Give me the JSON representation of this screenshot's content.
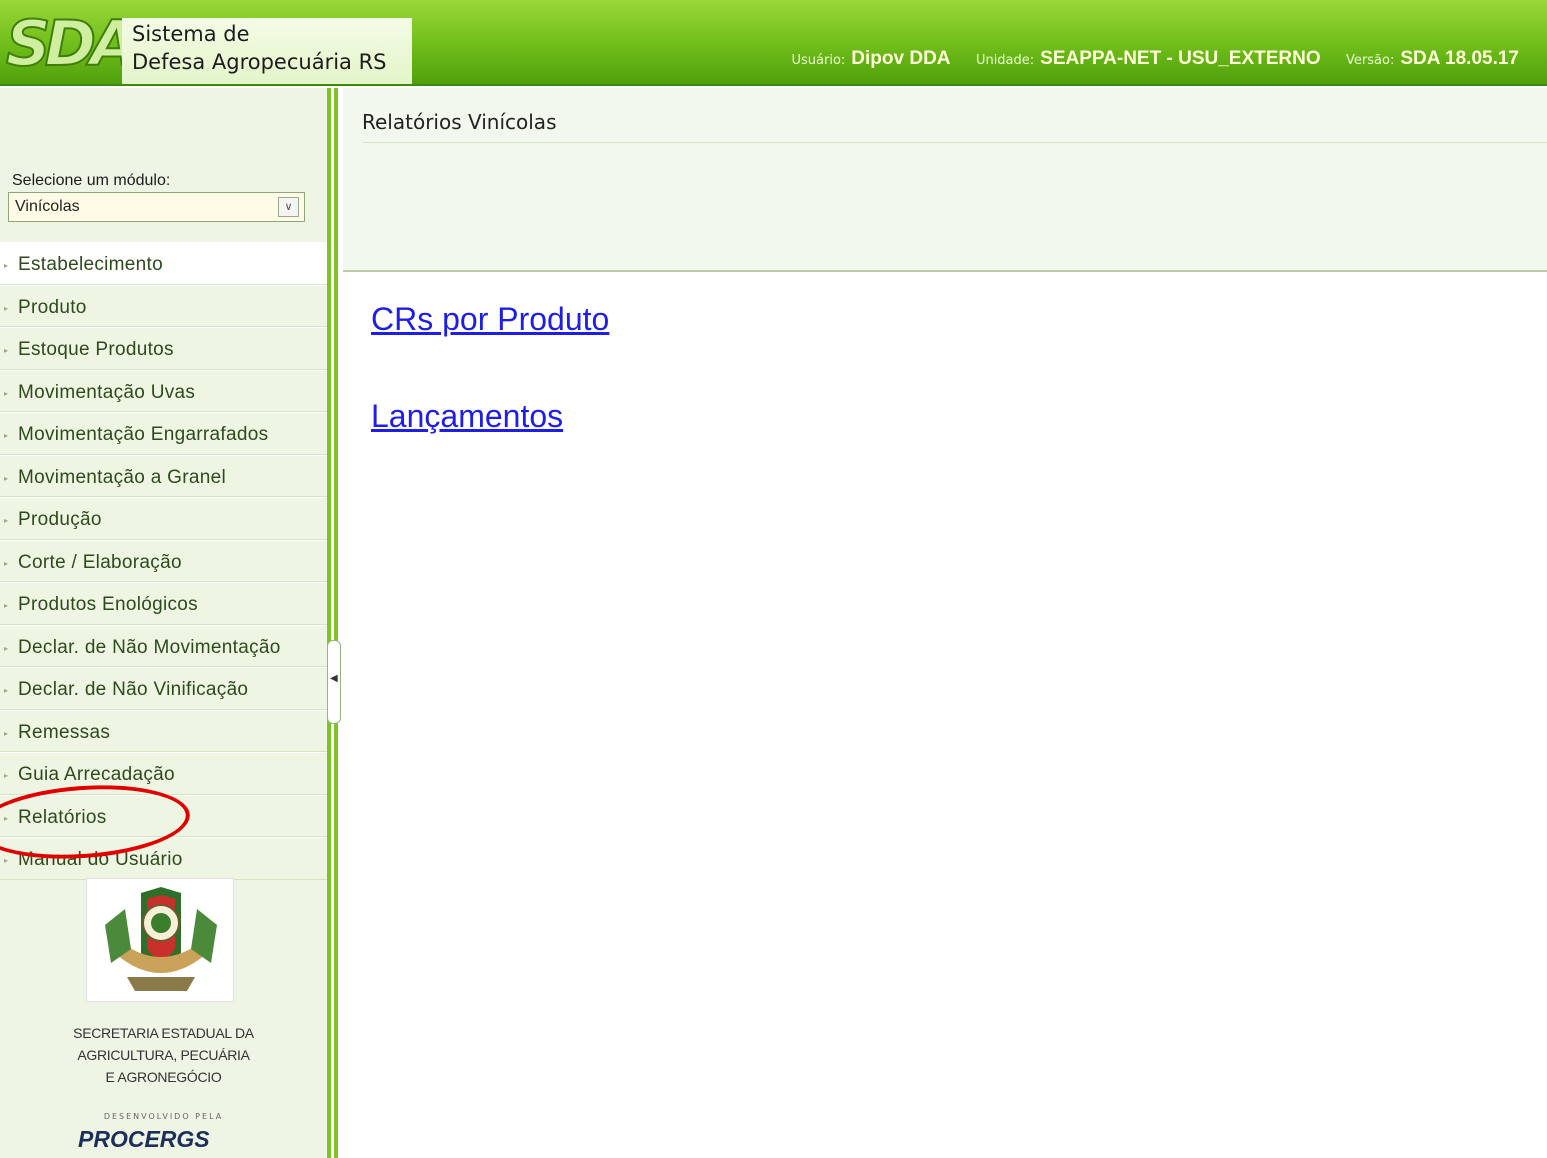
{
  "header": {
    "logo_text": "SDA",
    "system_name_line1": "Sistema de",
    "system_name_line2": "Defesa Agropecuária RS",
    "user_label": "Usuário:",
    "user_value": "Dipov DDA",
    "unit_label": "Unidade:",
    "unit_value": "SEAPPA-NET - USU_EXTERNO",
    "version_label": "Versão:",
    "version_value": "SDA 18.05.17",
    "colors": {
      "primary": "#6fbd1a",
      "light": "#9ad83a",
      "dark": "#4fa00c"
    }
  },
  "sidebar": {
    "module_label": "Selecione um módulo:",
    "module_selected": "Vinícolas",
    "items": [
      {
        "label": "Estabelecimento"
      },
      {
        "label": "Produto"
      },
      {
        "label": "Estoque Produtos"
      },
      {
        "label": "Movimentação Uvas"
      },
      {
        "label": "Movimentação Engarrafados"
      },
      {
        "label": "Movimentação a Granel"
      },
      {
        "label": "Produção"
      },
      {
        "label": "Corte / Elaboração"
      },
      {
        "label": "Produtos Enológicos"
      },
      {
        "label": "Declar. de Não Movimentação"
      },
      {
        "label": "Declar. de Não Vinificação"
      },
      {
        "label": "Remessas"
      },
      {
        "label": "Guia Arrecadação"
      },
      {
        "label": "Relatórios"
      },
      {
        "label": "Manual do Usuário"
      }
    ],
    "footer": {
      "secretaria_line1": "SECRETARIA ESTADUAL DA",
      "secretaria_line2": "AGRICULTURA, PECUÁRIA",
      "secretaria_line3": "E AGRONEGÓCIO",
      "developed_by": "DESENVOLVIDO PELA",
      "developer": "PROCERGS"
    }
  },
  "main": {
    "title": "Relatórios Vinícolas",
    "links": [
      {
        "label": "CRs por Produto"
      },
      {
        "label": "Lançamentos"
      }
    ]
  }
}
